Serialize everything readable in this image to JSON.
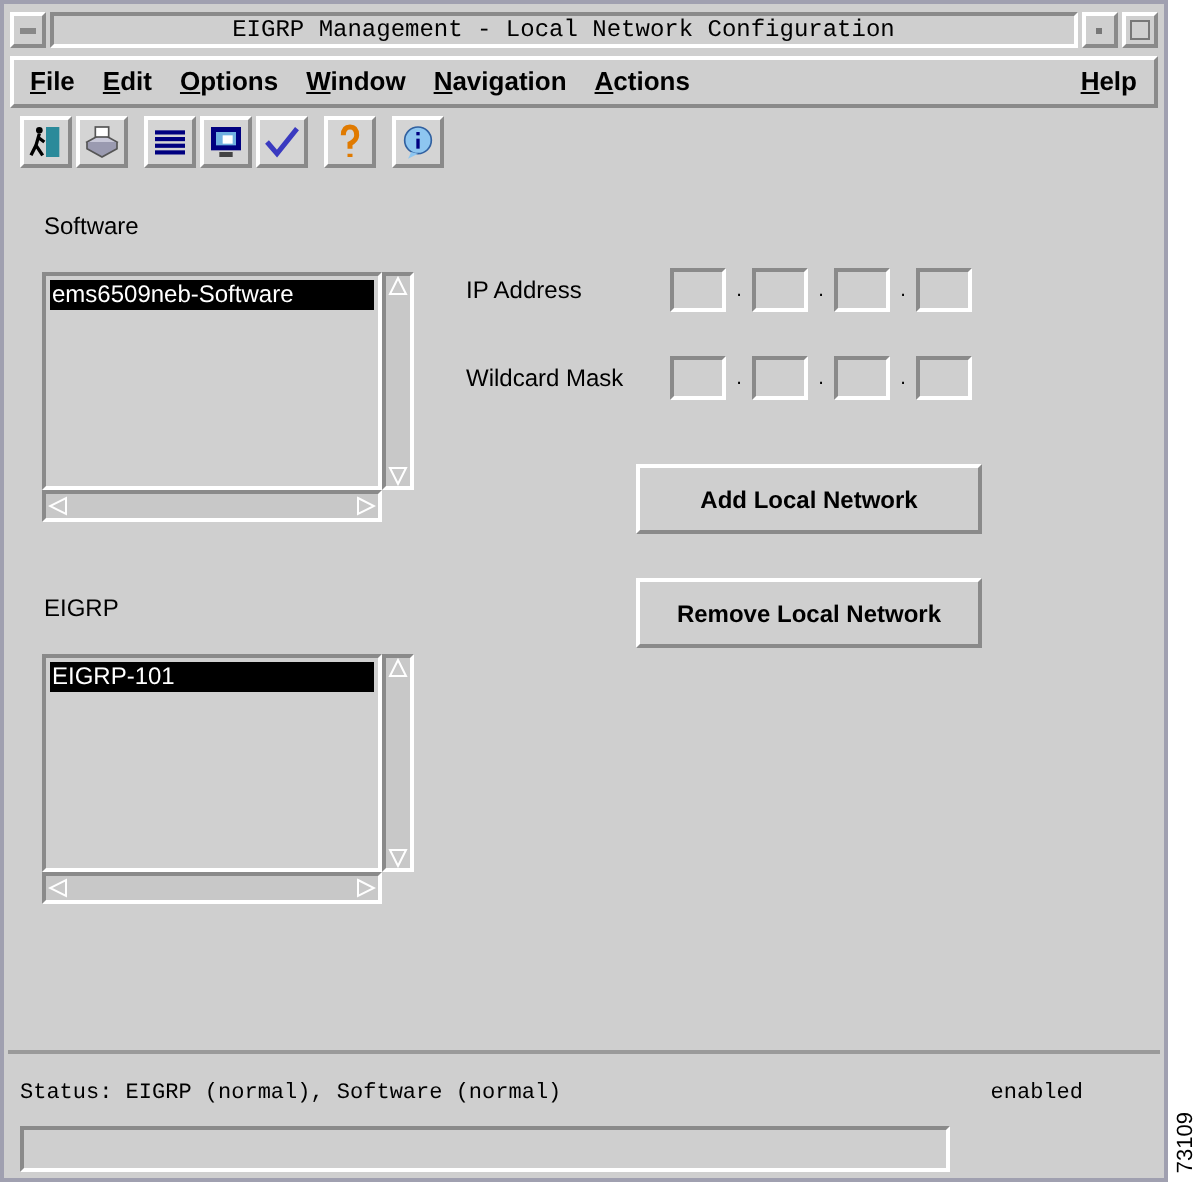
{
  "window": {
    "title": "EIGRP Management - Local Network Configuration"
  },
  "menu": [
    {
      "label": "File"
    },
    {
      "label": "Edit"
    },
    {
      "label": "Options"
    },
    {
      "label": "Window"
    },
    {
      "label": "Navigation"
    },
    {
      "label": "Actions"
    },
    {
      "label": "Help"
    }
  ],
  "toolbar": [
    {
      "tools": [
        {
          "kind": "exit"
        },
        {
          "kind": "print"
        }
      ]
    },
    {
      "tools": [
        {
          "kind": "list"
        },
        {
          "kind": "monitor"
        },
        {
          "kind": "check"
        }
      ]
    },
    {
      "tools": [
        {
          "kind": "help"
        }
      ]
    },
    {
      "tools": [
        {
          "kind": "info"
        }
      ]
    }
  ],
  "software": {
    "label": "Software",
    "items": [
      {
        "text": "ems6509neb-Software",
        "selected": true
      }
    ]
  },
  "eigrp": {
    "label": "EIGRP",
    "items": [
      {
        "text": "EIGRP-101",
        "selected": true
      }
    ]
  },
  "fields": [
    {
      "label": "IP Address",
      "separators": [
        ".",
        ".",
        "."
      ]
    },
    {
      "label": "Wildcard Mask",
      "separators": [
        ".",
        ".",
        "."
      ]
    }
  ],
  "buttons": [
    "Add Local Network",
    "Remove Local Network"
  ],
  "status_bar": {
    "text": "Status: EIGRP (normal), Software (normal)",
    "state": "enabled"
  },
  "figure_id": "73109"
}
